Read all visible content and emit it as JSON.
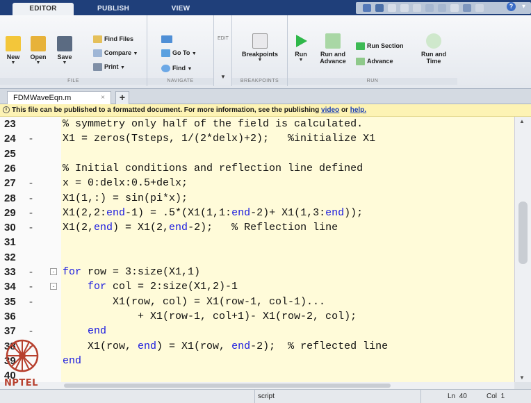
{
  "top_tabs": [
    {
      "label": "EDITOR",
      "active": true
    },
    {
      "label": "PUBLISH",
      "active": false
    },
    {
      "label": "VIEW",
      "active": false
    }
  ],
  "help_glyph": "?",
  "ribbon": {
    "file": {
      "label": "FILE",
      "new": "New",
      "open": "Open",
      "save": "Save",
      "find_files": "Find Files",
      "compare": "Compare",
      "print": "Print"
    },
    "navigate": {
      "label": "NAVIGATE",
      "go_to": "Go To",
      "find": "Find"
    },
    "edit": {
      "label": "EDIT"
    },
    "breakpoints": {
      "label": "BREAKPOINTS",
      "breakpoints": "Breakpoints"
    },
    "run": {
      "label": "RUN",
      "run": "Run",
      "run_and_advance": "Run and Advance",
      "run_section": "Run Section",
      "advance": "Advance",
      "run_and_time": "Run and Time"
    }
  },
  "file_tab": {
    "name": "FDMWaveEqn.m",
    "close": "×",
    "add": "+"
  },
  "infobar": {
    "text": "This file can be published to a formatted document. For more information, see the publishing",
    "link_video": "video",
    "or": "or",
    "link_help": "help."
  },
  "code_lines": [
    {
      "num": "23",
      "dash": "",
      "fold": "",
      "code": "% symmetry only half of the field is calculated."
    },
    {
      "num": "24",
      "dash": "-",
      "fold": "",
      "code": "X1 = zeros(Tsteps, 1/(2*delx)+2);   %initialize X1"
    },
    {
      "num": "25",
      "dash": "",
      "fold": "",
      "code": ""
    },
    {
      "num": "26",
      "dash": "",
      "fold": "",
      "code": "% Initial conditions and reflection line defined"
    },
    {
      "num": "27",
      "dash": "-",
      "fold": "",
      "code": "x = 0:delx:0.5+delx;"
    },
    {
      "num": "28",
      "dash": "-",
      "fold": "",
      "code": "X1(1,:) = sin(pi*x);"
    },
    {
      "num": "29",
      "dash": "-",
      "fold": "",
      "code": "X1(2,2:end-1) = .5*(X1(1,1:end-2)+ X1(1,3:end));"
    },
    {
      "num": "30",
      "dash": "-",
      "fold": "",
      "code": "X1(2,end) = X1(2,end-2);   % Reflection line"
    },
    {
      "num": "31",
      "dash": "",
      "fold": "",
      "code": ""
    },
    {
      "num": "32",
      "dash": "",
      "fold": "",
      "code": ""
    },
    {
      "num": "33",
      "dash": "-",
      "fold": "-",
      "code": "for row = 3:size(X1,1)"
    },
    {
      "num": "34",
      "dash": "-",
      "fold": "-",
      "code": "    for col = 2:size(X1,2)-1"
    },
    {
      "num": "35",
      "dash": "-",
      "fold": "",
      "code": "        X1(row, col) = X1(row-1, col-1)..."
    },
    {
      "num": "36",
      "dash": "",
      "fold": "",
      "code": "            + X1(row-1, col+1)- X1(row-2, col);"
    },
    {
      "num": "37",
      "dash": "-",
      "fold": "",
      "code": "    end"
    },
    {
      "num": "38",
      "dash": "-",
      "fold": "",
      "code": "    X1(row, end) = X1(row, end-2);  % reflected line"
    },
    {
      "num": "39",
      "dash": "",
      "fold": "",
      "code": "end"
    },
    {
      "num": "40",
      "dash": "",
      "fold": "",
      "code": ""
    }
  ],
  "status": {
    "type": "script",
    "ln_label": "Ln",
    "ln": "40",
    "col_label": "Col",
    "col": "1"
  },
  "logo_text": "NPTEL",
  "colors": {
    "tabstrip": "#1f3f7a",
    "infobar": "#fdf3b4",
    "code_bg": "#fffbd9",
    "keyword": "#1a1ae0",
    "run_green": "#2fb84a"
  }
}
